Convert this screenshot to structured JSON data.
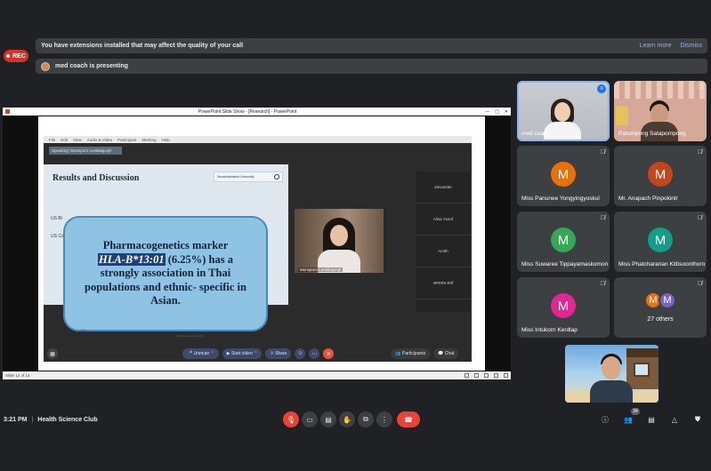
{
  "rec_label": "REC",
  "banners": {
    "extensions": {
      "message": "You have extensions installed that may affect the quality of your call",
      "learn_more": "Learn more",
      "dismiss": "Dismiss"
    },
    "presenting": {
      "message": "med coach is presenting"
    }
  },
  "share": {
    "window_title": "PowerPoint Slide Show - [Research] - PowerPoint",
    "win_buttons": [
      "—",
      "▢",
      "✕"
    ],
    "status_slide": "Slide 12 of 14",
    "zoom": {
      "menu": [
        "File",
        "Edit",
        "View",
        "Audio & Video",
        "Participant",
        "Meeting",
        "Help"
      ],
      "speaking": "Speaking: Monsporn Leelakajonjit",
      "slide_title": "Results and Discussion",
      "logo_text": "Srinakharinwirot University",
      "row_labels": [
        "US Bl",
        "US Cauca"
      ],
      "callout_line1": "Pharmacogenetics marker",
      "callout_highlight": "HLA-B*13:01",
      "callout_pct": "(6.25%)",
      "callout_line2": "has a strongly association in Thai populations and ethnic- specific in Asian.",
      "pct_label": "<1%",
      "footnote": "Pharmacogenetics of HLA...",
      "video_name": "Monsporn Leelakajonjit",
      "side_participants": [
        "alexander",
        "Alisa Yusof",
        "Amith",
        "अमरनाथ शर्मा"
      ],
      "controls": {
        "unmute": "Unmute",
        "start_video": "Start video",
        "share": "Share",
        "participants": "Participants",
        "chat": "Chat"
      }
    }
  },
  "tiles": [
    {
      "name": "med coach"
    },
    {
      "name": "Patompong Satapornpong"
    },
    {
      "name": "Miss Panunee Yongyingyoskul",
      "initial": "M",
      "color": "#e8710a"
    },
    {
      "name": "Mr. Anapach Pinpokintr",
      "initial": "M",
      "color": "#c5461c"
    },
    {
      "name": "Miss Suwaree Tippayamaskomon",
      "initial": "M",
      "color": "#34a853"
    },
    {
      "name": "Miss Phatcharanan Kittisoonthorn",
      "initial": "M",
      "color": "#129e8a"
    },
    {
      "name": "Miss Intukorn Kerdlap",
      "initial": "M",
      "color": "#e52592"
    }
  ],
  "others": {
    "initials": [
      {
        "letter": "M",
        "color": "#e8710a"
      },
      {
        "letter": "M",
        "color": "#7c5fc7"
      }
    ],
    "label": "27 others"
  },
  "bottom": {
    "time": "3:21 PM",
    "separator": "|",
    "meeting_name": "Health Science Club",
    "participant_badge": "34"
  }
}
